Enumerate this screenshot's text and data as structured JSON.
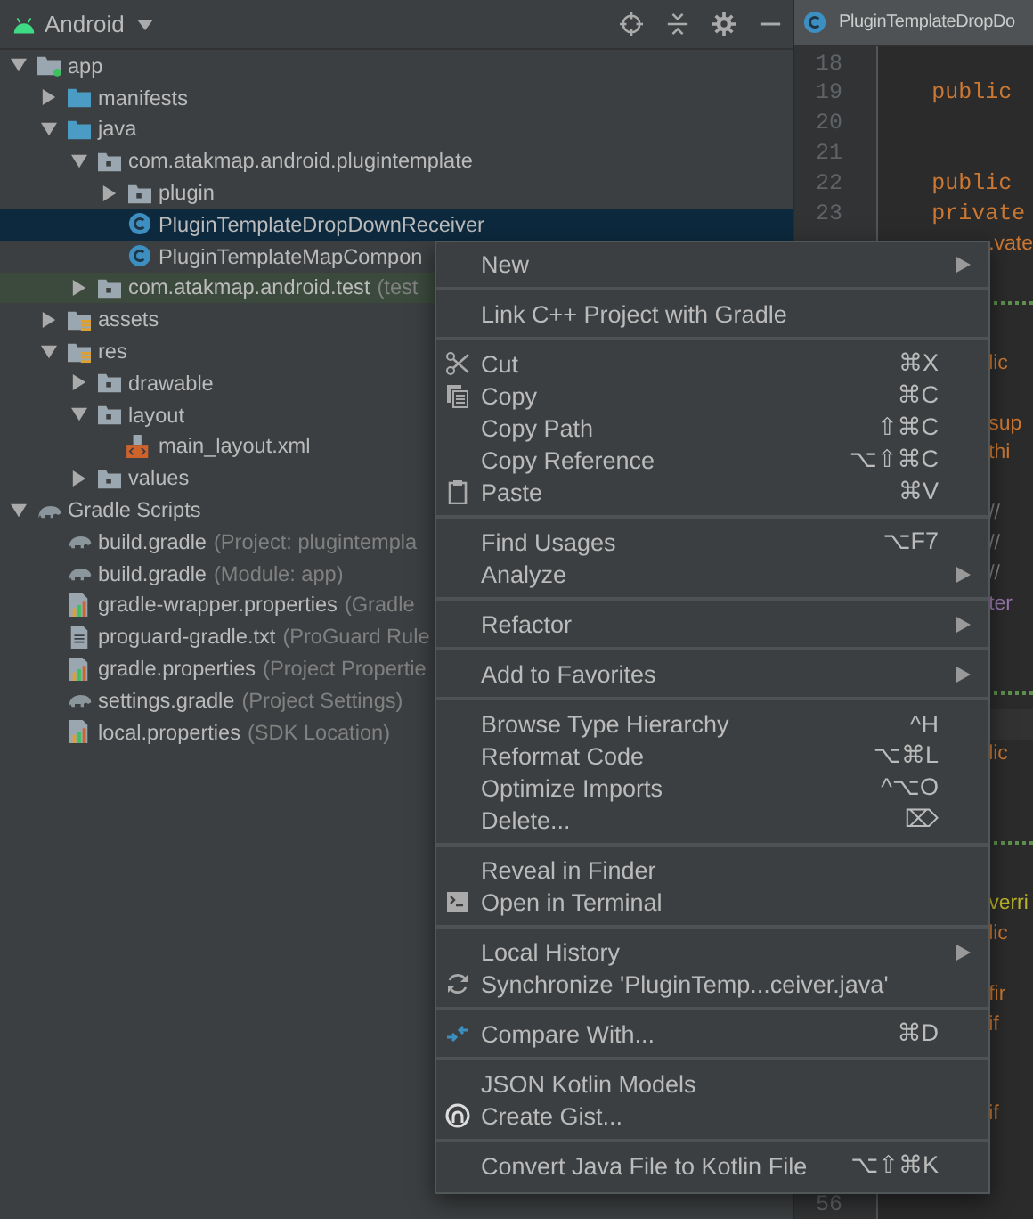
{
  "project_panel": {
    "view": "Android",
    "tree": [
      {
        "label": "app",
        "kind": "module",
        "expanded": true,
        "selected": false,
        "children": [
          {
            "label": "manifests",
            "kind": "folder",
            "expanded": false,
            "selected": false
          },
          {
            "label": "java",
            "kind": "folder",
            "expanded": true,
            "selected": false,
            "children": [
              {
                "label": "com.atakmap.android.plugintemplate",
                "kind": "package",
                "expanded": true,
                "selected": false,
                "children": [
                  {
                    "label": "plugin",
                    "kind": "package",
                    "expanded": false,
                    "selected": false
                  },
                  {
                    "label": "PluginTemplateDropDownReceiver",
                    "kind": "class",
                    "selected": true
                  },
                  {
                    "label": "PluginTemplateMapCompon",
                    "kind": "class",
                    "selected": false
                  }
                ]
              },
              {
                "label": "com.atakmap.android.test",
                "hint": "(test",
                "kind": "test-package",
                "expanded": false,
                "selected": false
              }
            ]
          },
          {
            "label": "assets",
            "kind": "res-folder",
            "expanded": false,
            "selected": false
          },
          {
            "label": "res",
            "kind": "res-folder",
            "expanded": true,
            "selected": false,
            "children": [
              {
                "label": "drawable",
                "kind": "package",
                "expanded": false,
                "selected": false
              },
              {
                "label": "layout",
                "kind": "package",
                "expanded": true,
                "selected": false,
                "children": [
                  {
                    "label": "main_layout.xml",
                    "kind": "xml",
                    "selected": false
                  }
                ]
              },
              {
                "label": "values",
                "kind": "package",
                "expanded": false,
                "selected": false
              }
            ]
          }
        ]
      },
      {
        "label": "Gradle Scripts",
        "kind": "gradle",
        "expanded": true,
        "selected": false,
        "children": [
          {
            "label": "build.gradle",
            "hint": "(Project: plugintempla",
            "kind": "gradle",
            "selected": false
          },
          {
            "label": "build.gradle",
            "hint": "(Module: app)",
            "kind": "gradle",
            "selected": false
          },
          {
            "label": "gradle-wrapper.properties",
            "hint": "(Gradle",
            "kind": "properties",
            "selected": false
          },
          {
            "label": "proguard-gradle.txt",
            "hint": "(ProGuard Rule",
            "kind": "text",
            "selected": false
          },
          {
            "label": "gradle.properties",
            "hint": "(Project Propertie",
            "kind": "properties",
            "selected": false
          },
          {
            "label": "settings.gradle",
            "hint": "(Project Settings)",
            "kind": "gradle",
            "selected": false
          },
          {
            "label": "local.properties",
            "hint": "(SDK Location)",
            "kind": "properties",
            "selected": false
          }
        ]
      }
    ]
  },
  "editor": {
    "tab": "PluginTemplateDropDo",
    "lines": [
      {
        "kind": "blank",
        "number": "18"
      },
      {
        "kind": "code",
        "number": "19",
        "text": "public"
      },
      {
        "kind": "blank",
        "number": "20"
      },
      {
        "kind": "blank",
        "number": "21"
      },
      {
        "kind": "code",
        "number": "22",
        "text": "public"
      },
      {
        "kind": "code",
        "number": "23",
        "text": "private"
      },
      {
        "kind": "clipped",
        "text": ".vate"
      },
      {
        "kind": "blank"
      },
      {
        "kind": "separator"
      },
      {
        "kind": "blank"
      },
      {
        "kind": "clipped",
        "text": "lic"
      },
      {
        "kind": "blank"
      },
      {
        "kind": "clipped",
        "text": "sup"
      },
      {
        "kind": "clipped",
        "text": "thi"
      },
      {
        "kind": "blank"
      },
      {
        "kind": "comment",
        "text": "//"
      },
      {
        "kind": "comment",
        "text": "//"
      },
      {
        "kind": "comment",
        "text": "//"
      },
      {
        "kind": "field",
        "text": "ter"
      },
      {
        "kind": "blank"
      },
      {
        "kind": "blank"
      },
      {
        "kind": "separator"
      },
      {
        "kind": "current"
      },
      {
        "kind": "clipped",
        "text": "lic"
      },
      {
        "kind": "blank"
      },
      {
        "kind": "blank"
      },
      {
        "kind": "separator"
      },
      {
        "kind": "blank"
      },
      {
        "kind": "annotation",
        "text": "verri"
      },
      {
        "kind": "clipped",
        "text": "lic"
      },
      {
        "kind": "blank"
      },
      {
        "kind": "clipped",
        "text": "fir"
      },
      {
        "kind": "clipped",
        "text": "if"
      },
      {
        "kind": "blank"
      },
      {
        "kind": "blank"
      },
      {
        "kind": "clipped",
        "text": "if"
      },
      {
        "kind": "blank"
      },
      {
        "kind": "blank"
      },
      {
        "kind": "blank",
        "number": "56"
      }
    ]
  },
  "context_menu": {
    "groups": [
      [
        {
          "label": "New",
          "submenu": true
        }
      ],
      [
        {
          "label": "Link C++ Project with Gradle",
          "submenu": false
        }
      ],
      [
        {
          "label": "Cut",
          "shortcut": "⌘X",
          "kind": "scissors",
          "submenu": false
        },
        {
          "label": "Copy",
          "shortcut": "⌘C",
          "kind": "copy",
          "submenu": false
        },
        {
          "label": "Copy Path",
          "shortcut": "⇧⌘C",
          "submenu": false
        },
        {
          "label": "Copy Reference",
          "shortcut": "⌥⇧⌘C",
          "submenu": false
        },
        {
          "label": "Paste",
          "shortcut": "⌘V",
          "kind": "clipboard",
          "submenu": false
        }
      ],
      [
        {
          "label": "Find Usages",
          "shortcut": "⌥F7",
          "submenu": false
        },
        {
          "label": "Analyze",
          "submenu": true
        }
      ],
      [
        {
          "label": "Refactor",
          "submenu": true
        }
      ],
      [
        {
          "label": "Add to Favorites",
          "submenu": true
        }
      ],
      [
        {
          "label": "Browse Type Hierarchy",
          "shortcut": "^H",
          "submenu": false
        },
        {
          "label": "Reformat Code",
          "shortcut": "⌥⌘L",
          "submenu": false
        },
        {
          "label": "Optimize Imports",
          "shortcut": "^⌥O",
          "submenu": false
        },
        {
          "label": "Delete...",
          "shortcut": "⌦",
          "submenu": false
        }
      ],
      [
        {
          "label": "Reveal in Finder",
          "submenu": false
        },
        {
          "label": "Open in Terminal",
          "kind": "terminal",
          "submenu": false
        }
      ],
      [
        {
          "label": "Local History",
          "submenu": true
        },
        {
          "label": "Synchronize 'PluginTemp...ceiver.java'",
          "kind": "sync",
          "submenu": false
        }
      ],
      [
        {
          "label": "Compare With...",
          "shortcut": "⌘D",
          "kind": "compare",
          "submenu": false
        }
      ],
      [
        {
          "label": "JSON Kotlin Models",
          "submenu": false
        },
        {
          "label": "Create Gist...",
          "kind": "github",
          "submenu": false
        }
      ],
      [
        {
          "label": "Convert Java File to Kotlin File",
          "shortcut": "⌥⇧⌘K",
          "submenu": false
        }
      ]
    ]
  }
}
